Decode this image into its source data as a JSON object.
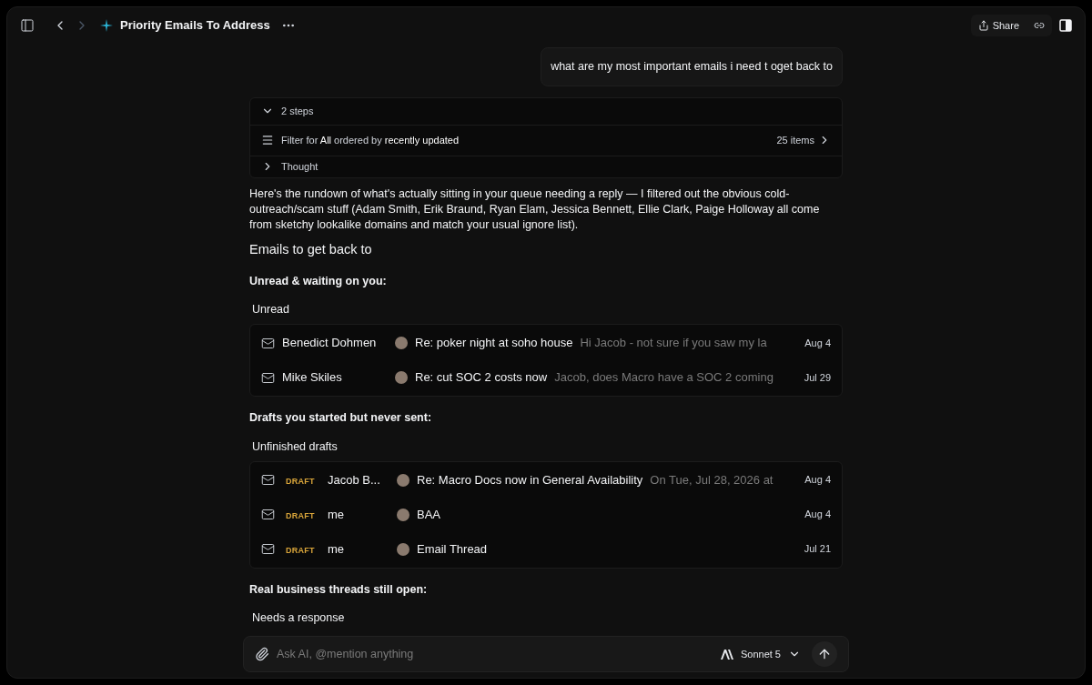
{
  "header": {
    "title": "Priority Emails To Address",
    "share": "Share"
  },
  "user_message": "what are my most important emails i need t oget back to",
  "steps": {
    "summary": "2 steps",
    "expanded": true,
    "filter": "Filter for **All** ordered by **recently updated**",
    "count": "25 items",
    "thought": "Thought"
  },
  "reply": {
    "intro": "Here's the rundown of what's actually sitting in your queue needing a reply — I filtered out the obvious cold-outreach/scam stuff (Adam Smith, Erik Braund, Ryan Elam, Jessica Bennett, Ellie Clark, Paige Holloway all come from sketchy lookalike domains and match your usual ignore list).",
    "heading": "Emails to get back to",
    "sections": [
      {
        "title": "Unread & waiting on you:",
        "list_title": "Unread",
        "emails": [
          {
            "draft": false,
            "from": "Benedict Dohmen",
            "subject": "Re: poker night at soho house",
            "preview": "Hi Jacob - not sure if you saw my la",
            "date": "Aug 4"
          },
          {
            "draft": false,
            "from": "Mike Skiles",
            "subject": "Re: cut SOC 2 costs now",
            "preview": "Jacob, does Macro have a SOC 2 coming",
            "date": "Jul 29"
          }
        ]
      },
      {
        "title": "Drafts you started but never sent:",
        "list_title": "Unfinished drafts",
        "emails": [
          {
            "draft": true,
            "badge": "DRAFT",
            "from": "Jacob B...",
            "subject": "Re: Macro Docs now in General Availability",
            "preview": "On Tue, Jul 28, 2026 at",
            "date": "Aug 4"
          },
          {
            "draft": true,
            "badge": "DRAFT",
            "from": "me",
            "subject": "BAA",
            "date": "Aug 4"
          },
          {
            "draft": true,
            "badge": "DRAFT",
            "from": "me",
            "subject": "Email Thread",
            "date": "Jul 21"
          }
        ]
      },
      {
        "title": "Real business threads still open:",
        "list_title": "Needs a response"
      }
    ]
  },
  "composer": {
    "placeholder": "Ask AI, @mention anything",
    "model": "Sonnet 5"
  }
}
